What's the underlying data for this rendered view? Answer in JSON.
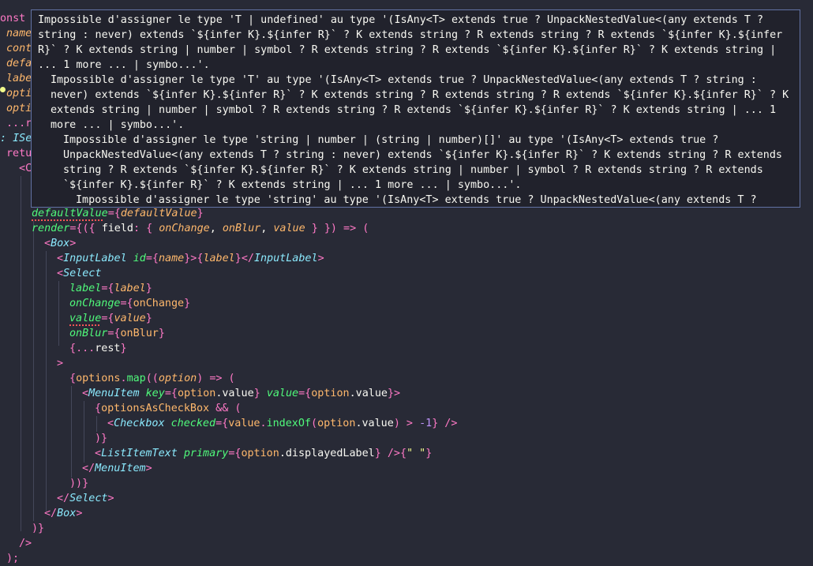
{
  "left_fragments": [
    "onst",
    "name",
    "cont",
    "defa",
    "labe",
    "opti",
    "opti",
    "...r",
    ": ISe",
    "retu",
    "<C"
  ],
  "tooltip": {
    "messages": [
      "Impossible d'assigner le type 'T | undefined' au type '(IsAny<T> extends true ? UnpackNestedValue<(any extends T ? string : never) extends `${infer K}.${infer R}` ? K extends string ? R extends string ? R extends `${infer K}.${infer R}` ? K extends string | number | symbol ? R extends string ? R extends `${infer K}.${infer R}` ? K extends string | ... 1 more ... | symbo...'.",
      "Impossible d'assigner le type 'T' au type '(IsAny<T> extends true ? UnpackNestedValue<(any extends T ? string : never) extends `${infer K}.${infer R}` ? K extends string ? R extends string ? R extends `${infer K}.${infer R}` ? K extends string | number | symbol ? R extends string ? R extends `${infer K}.${infer R}` ? K extends string | ... 1 more ... | symbo...'.",
      "Impossible d'assigner le type 'string | number | (string | number)[]' au type '(IsAny<T> extends true ? UnpackNestedValue<(any extends T ? string : never) extends `${infer K}.${infer R}` ? K extends string ? R extends string ? R extends `${infer K}.${infer R}` ? K extends string | number | symbol ? R extends string ? R extends `${infer K}.${infer R}` ? K extends string | ... 1 more ... | symbo...'.",
      "Impossible d'assigner le type 'string' au type '(IsAny<T> extends true ? UnpackNestedValue<(any extends T ? string : never) extends `${infer K}.${infer R}` ? K extends string ? R extends string ? R extends `${infer K}.${infer R}` ? K extends"
    ]
  },
  "code": {
    "l1_a": "defaultValue",
    "l1_b": "={",
    "l1_c": "defaultValue",
    "l1_d": "}",
    "l2_a": "render",
    "l2_b": "={({ ",
    "l2_c": "field",
    "l2_d": ": { ",
    "l2_e": "onChange",
    "l2_f": ", ",
    "l2_g": "onBlur",
    "l2_h": ", ",
    "l2_i": "value",
    "l2_j": " } }) => (",
    "l3_a": "<",
    "l3_b": "Box",
    "l3_c": ">",
    "l4_a": "<",
    "l4_b": "InputLabel",
    "l4_c": " ",
    "l4_d": "id",
    "l4_e": "={",
    "l4_f": "name",
    "l4_g": "}>",
    "l4_h": "{",
    "l4_i": "label",
    "l4_j": "}",
    "l4_k": "</",
    "l4_l": "InputLabel",
    "l4_m": ">",
    "l5_a": "<",
    "l5_b": "Select",
    "l6_a": "label",
    "l6_b": "={",
    "l6_c": "label",
    "l6_d": "}",
    "l7_a": "onChange",
    "l7_b": "={",
    "l7_c": "onChange",
    "l7_d": "}",
    "l8_a": "value",
    "l8_b": "={",
    "l8_c": "value",
    "l8_d": "}",
    "l9_a": "onBlur",
    "l9_b": "={",
    "l9_c": "onBlur",
    "l9_d": "}",
    "l10_a": "{",
    "l10_b": "...",
    "l10_c": "rest",
    "l10_d": "}",
    "l11_a": ">",
    "l12_a": "{",
    "l12_b": "options",
    "l12_c": ".",
    "l12_d": "map",
    "l12_e": "((",
    "l12_f": "option",
    "l12_g": ") => (",
    "l13_a": "<",
    "l13_b": "MenuItem",
    "l13_c": " ",
    "l13_d": "key",
    "l13_e": "={",
    "l13_f": "option",
    "l13_g": ".value",
    "l13_h": "} ",
    "l13_i": "value",
    "l13_j": "={",
    "l13_k": "option",
    "l13_l": ".value",
    "l13_m": "}>",
    "l14_a": "{",
    "l14_b": "optionsAsCheckBox",
    "l14_c": " && (",
    "l15_a": "<",
    "l15_b": "Checkbox",
    "l15_c": " ",
    "l15_d": "checked",
    "l15_e": "={",
    "l15_f": "value",
    "l15_g": ".",
    "l15_h": "indexOf",
    "l15_i": "(",
    "l15_j": "option",
    "l15_k": ".value",
    "l15_l": ") > ",
    "l15_m": "-1",
    "l15_n": "} />",
    "l16_a": ")}",
    "l17_a": "<",
    "l17_b": "ListItemText",
    "l17_c": " ",
    "l17_d": "primary",
    "l17_e": "={",
    "l17_f": "option",
    "l17_g": ".displayedLabel",
    "l17_h": "} />",
    "l17_i": "{",
    "l17_j": "\" \"",
    "l17_k": "}",
    "l18_a": "</",
    "l18_b": "MenuItem",
    "l18_c": ">",
    "l19_a": "))}",
    "l20_a": "</",
    "l20_b": "Select",
    "l20_c": ">",
    "l21_a": "</",
    "l21_b": "Box",
    "l21_c": ">",
    "l22_a": ")}",
    "l23_a": "/>",
    "l24_a": ");"
  }
}
